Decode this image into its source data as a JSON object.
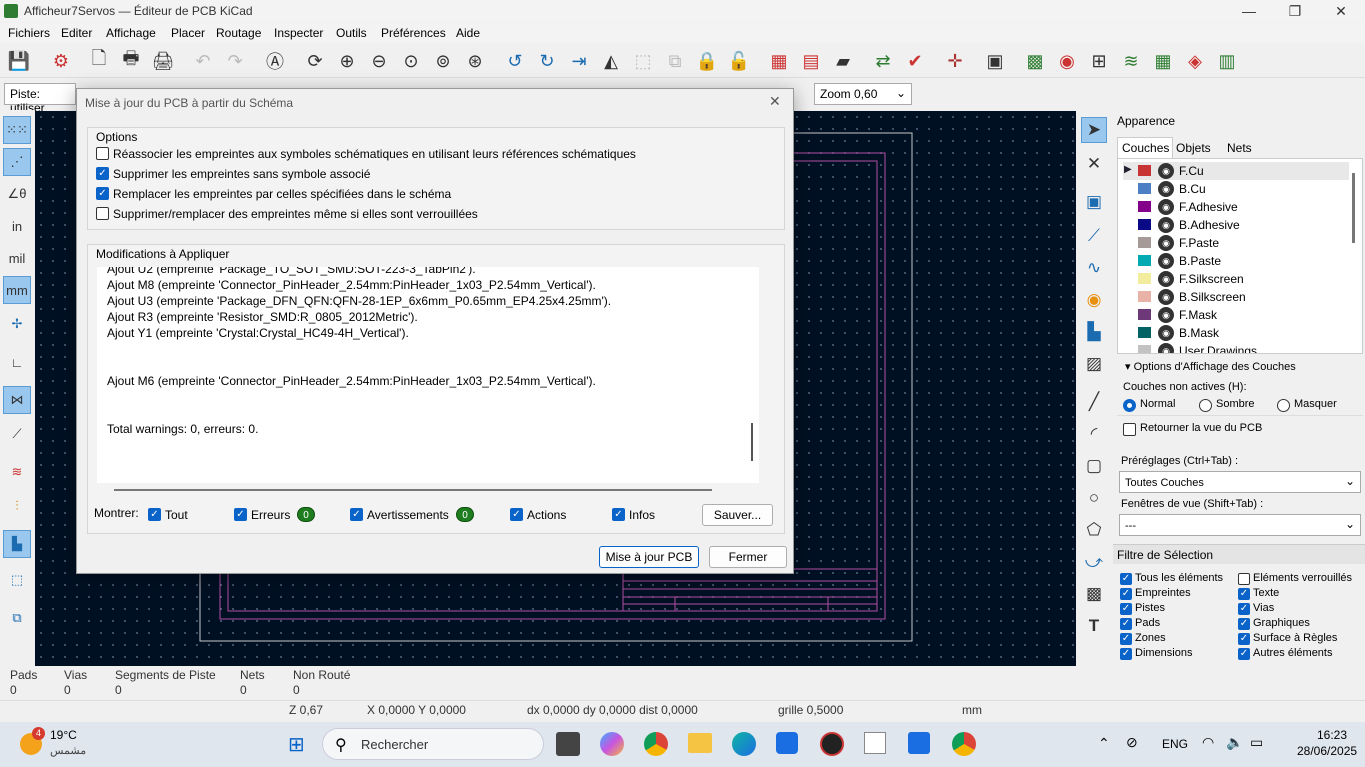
{
  "window": {
    "title": "Afficheur7Servos — Éditeur de PCB KiCad",
    "minimize": "—",
    "maximize": "❐",
    "close": "✕"
  },
  "menu": [
    "Fichiers",
    "Editer",
    "Affichage",
    "Placer",
    "Routage",
    "Inspecter",
    "Outils",
    "Préférences",
    "Aide"
  ],
  "toolbar2": {
    "track_label": "Piste: utiliser",
    "zoom": "Zoom 0,60"
  },
  "dialog": {
    "title": "Mise à jour du PCB à partir du  Schéma",
    "close": "✕",
    "options_title": "Options",
    "options": [
      {
        "label": "Réassocier les empreintes aux symboles schématiques en utilisant leurs références schématiques",
        "checked": false
      },
      {
        "label": "Supprimer les empreintes sans symbole associé",
        "checked": true
      },
      {
        "label": "Remplacer les empreintes par celles spécifiées dans le schéma",
        "checked": true
      },
      {
        "label": "Supprimer/remplacer des empreintes même si elles sont verrouillées",
        "checked": false
      }
    ],
    "changes_title": "Modifications à Appliquer",
    "log": [
      "Ajout U2 (empreinte 'Package_TO_SOT_SMD:SOT-223-3_TabPin2').",
      "Ajout M8 (empreinte 'Connector_PinHeader_2.54mm:PinHeader_1x03_P2.54mm_Vertical').",
      "Ajout U3 (empreinte 'Package_DFN_QFN:QFN-28-1EP_6x6mm_P0.65mm_EP4.25x4.25mm').",
      "Ajout R3 (empreinte 'Resistor_SMD:R_0805_2012Metric').",
      "Ajout Y1 (empreinte 'Crystal:Crystal_HC49-4H_Vertical').",
      "",
      "",
      "Ajout M6 (empreinte 'Connector_PinHeader_2.54mm:PinHeader_1x03_P2.54mm_Vertical').",
      "",
      "",
      "Total warnings: 0, erreurs: 0."
    ],
    "show_label": "Montrer:",
    "filters": {
      "all": "Tout",
      "errors": "Erreurs",
      "errors_count": "0",
      "warnings": "Avertissements",
      "warnings_count": "0",
      "actions": "Actions",
      "infos": "Infos"
    },
    "save_button": "Sauver...",
    "update_button": "Mise à jour PCB",
    "close_button": "Fermer"
  },
  "appearance": {
    "title": "Apparence",
    "tabs": [
      "Couches",
      "Objets",
      "Nets"
    ],
    "layers": [
      {
        "name": "F.Cu",
        "color": "#c83434"
      },
      {
        "name": "B.Cu",
        "color": "#4d7fc4"
      },
      {
        "name": "F.Adhesive",
        "color": "#84008a"
      },
      {
        "name": "B.Adhesive",
        "color": "#0b0a86"
      },
      {
        "name": "F.Paste",
        "color": "#a59a97"
      },
      {
        "name": "B.Paste",
        "color": "#01aab3"
      },
      {
        "name": "F.Silkscreen",
        "color": "#f2ed9e"
      },
      {
        "name": "B.Silkscreen",
        "color": "#e8b2a7"
      },
      {
        "name": "F.Mask",
        "color": "#6e3979"
      },
      {
        "name": "B.Mask",
        "color": "#026264"
      },
      {
        "name": "User.Drawings",
        "color": "#c2c2c2"
      }
    ],
    "display_options": "Options d'Affichage des Couches",
    "inactive_label": "Couches non actives (H):",
    "inactive_options": [
      "Normal",
      "Sombre",
      "Masquer"
    ],
    "flip_label": "Retourner la vue du PCB",
    "presets_label": "Préréglages (Ctrl+Tab) :",
    "presets_value": "Toutes Couches",
    "viewports_label": "Fenêtres de vue (Shift+Tab) :",
    "viewports_value": "---"
  },
  "selection_filter": {
    "title": "Filtre de Sélection",
    "items": [
      {
        "label": "Tous les éléments",
        "checked": true
      },
      {
        "label": "Eléments verrouillés",
        "checked": false
      },
      {
        "label": "Empreintes",
        "checked": true
      },
      {
        "label": "Texte",
        "checked": true
      },
      {
        "label": "Pistes",
        "checked": true
      },
      {
        "label": "Vias",
        "checked": true
      },
      {
        "label": "Pads",
        "checked": true
      },
      {
        "label": "Graphiques",
        "checked": true
      },
      {
        "label": "Zones",
        "checked": true
      },
      {
        "label": "Surface à Règles",
        "checked": true
      },
      {
        "label": "Dimensions",
        "checked": true
      },
      {
        "label": "Autres éléments",
        "checked": true
      }
    ]
  },
  "status": {
    "pads_label": "Pads",
    "pads": "0",
    "vias_label": "Vias",
    "vias": "0",
    "segments_label": "Segments de Piste",
    "segments": "0",
    "nets_label": "Nets",
    "nets": "0",
    "unrouted_label": "Non Routé",
    "unrouted": "0",
    "z": "Z 0,67",
    "xy": "X 0,0000  Y 0,0000",
    "delta": "dx 0,0000  dy 0,0000  dist 0,0000",
    "grid": "grille 0,5000",
    "units": "mm"
  },
  "taskbar": {
    "weather_temp": "19°C",
    "weather_desc": "مشمس",
    "weather_badge": "4",
    "search": "Rechercher",
    "lang": "ENG",
    "time": "16:23",
    "date": "28/06/2025"
  }
}
